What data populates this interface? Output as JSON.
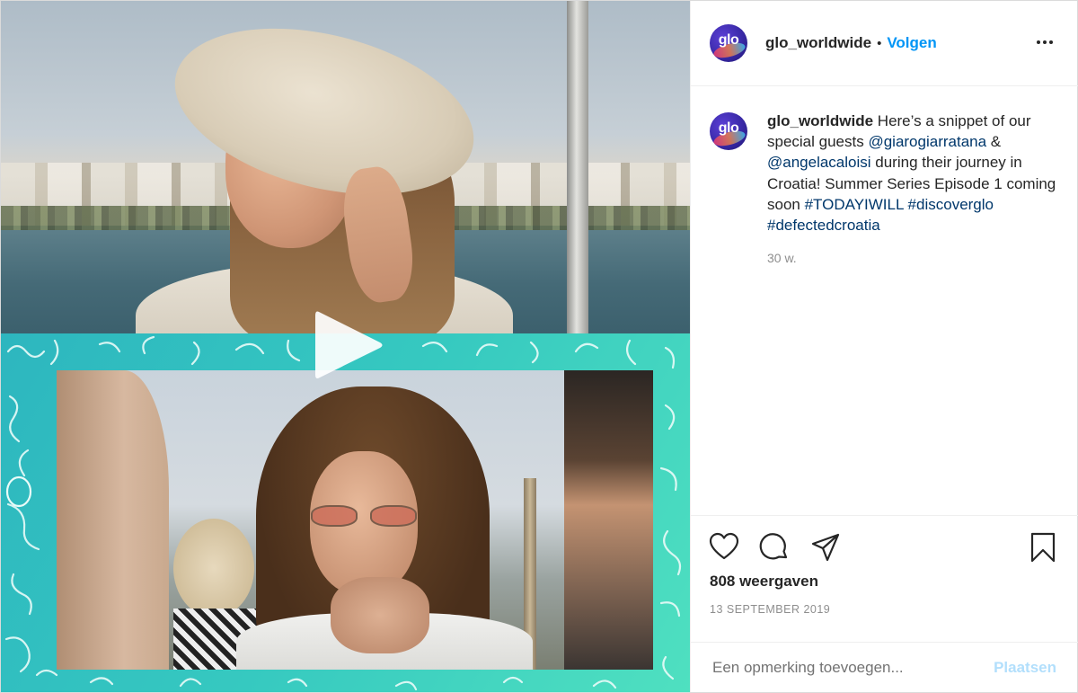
{
  "header": {
    "avatar_text": "glo",
    "username": "glo_worldwide",
    "separator": "•",
    "follow_label": "Volgen"
  },
  "caption": {
    "avatar_text": "glo",
    "username": "glo_worldwide",
    "text_1": " Here’s a snippet of our special guests ",
    "mention_1": "@giarogiarratana",
    "text_2": " & ",
    "mention_2": "@angelacaloisi",
    "text_3": " during their journey in Croatia! Summer Series Episode 1 coming soon ",
    "hashtag_1": "#TODAYIWILL",
    "hashtag_2": "#discoverglo",
    "hashtag_3": "#defectedcroatia",
    "time": "30 w."
  },
  "stats": {
    "views": "808 weergaven",
    "date": "13 SEPTEMBER 2019"
  },
  "comment": {
    "placeholder": "Een opmerking toevoegen...",
    "post_label": "Plaatsen"
  },
  "colors": {
    "link": "#00376b",
    "follow": "#0095f6",
    "post_disabled": "#b2dffc",
    "frame": "#36c9c0"
  },
  "icons": [
    "heart-icon",
    "comment-icon",
    "share-icon",
    "bookmark-icon",
    "more-icon",
    "play-icon"
  ]
}
